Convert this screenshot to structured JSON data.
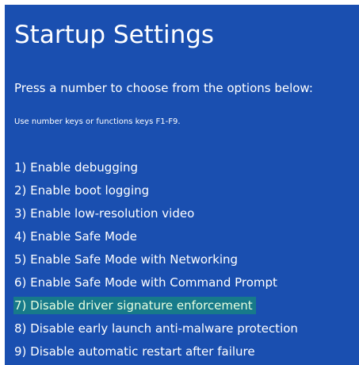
{
  "title": "Startup Settings",
  "instruction": "Press a number to choose from the options below:",
  "hint": "Use number keys or functions keys F1-F9.",
  "options": [
    {
      "label": "1) Enable debugging"
    },
    {
      "label": "2) Enable boot logging"
    },
    {
      "label": "3) Enable low-resolution video"
    },
    {
      "label": "4) Enable Safe Mode"
    },
    {
      "label": "5) Enable Safe Mode with Networking"
    },
    {
      "label": "6) Enable Safe Mode with Command Prompt"
    },
    {
      "label": "7) Disable driver signature enforcement",
      "highlighted": true
    },
    {
      "label": "8) Disable early launch anti-malware protection"
    },
    {
      "label": "9) Disable automatic restart after failure"
    }
  ],
  "colors": {
    "background": "#1a4fb0",
    "text": "#ffffff",
    "highlight": "#177a8a"
  }
}
